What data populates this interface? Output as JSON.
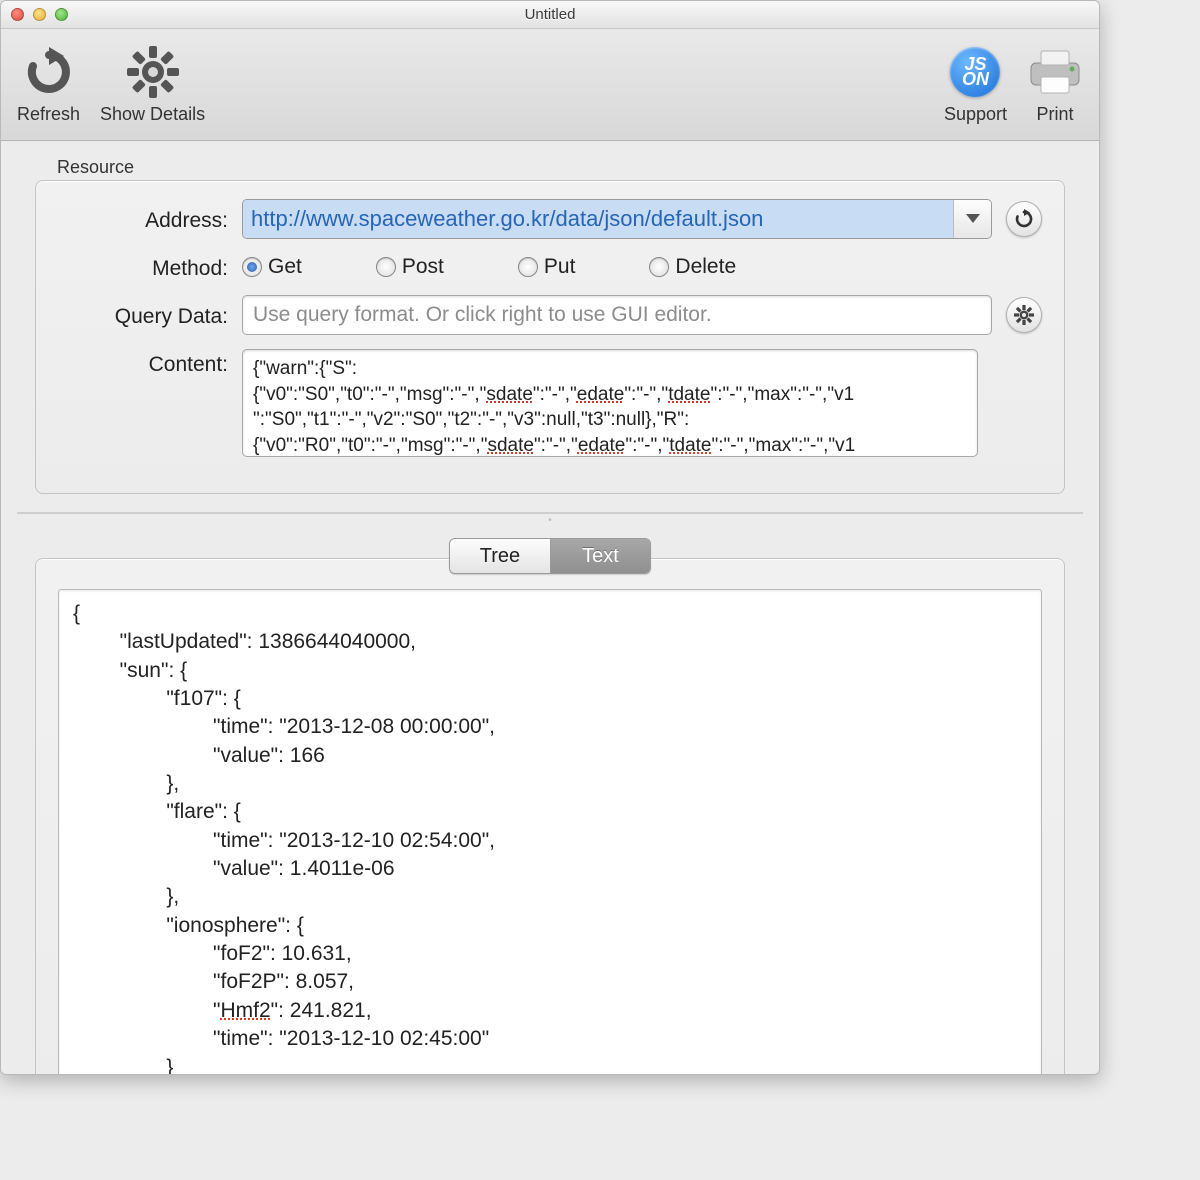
{
  "window": {
    "title": "Untitled"
  },
  "toolbar": {
    "refresh": "Refresh",
    "show_details": "Show Details",
    "support": "Support",
    "print": "Print",
    "json_badge": "JS\nON"
  },
  "resource": {
    "group_label": "Resource",
    "address_label": "Address:",
    "address_value": "http://www.spaceweather.go.kr/data/json/default.json",
    "method_label": "Method:",
    "methods": {
      "get": "Get",
      "post": "Post",
      "put": "Put",
      "delete": "Delete"
    },
    "selected_method": "get",
    "query_label": "Query Data:",
    "query_placeholder": "Use query format. Or click right to use GUI editor.",
    "content_label": "Content:",
    "content_lines": [
      "{\"warn\":{\"S\":",
      "{\"v0\":\"S0\",\"t0\":\"-\",\"msg\":\"-\",\"sdate\":\"-\",\"edate\":\"-\",\"tdate\":\"-\",\"max\":\"-\",\"v1",
      "\":\"S0\",\"t1\":\"-\",\"v2\":\"S0\",\"t2\":\"-\",\"v3\":null,\"t3\":null},\"R\":",
      "{\"v0\":\"R0\",\"t0\":\"-\",\"msg\":\"-\",\"sdate\":\"-\",\"edate\":\"-\",\"tdate\":\"-\",\"max\":\"-\",\"v1"
    ]
  },
  "tabs": {
    "tree": "Tree",
    "text": "Text",
    "active": "text"
  },
  "response_text": "{\n        \"lastUpdated\": 1386644040000,\n        \"sun\": {\n                \"f107\": {\n                        \"time\": \"2013-12-08 00:00:00\",\n                        \"value\": 166\n                },\n                \"flare\": {\n                        \"time\": \"2013-12-10 02:54:00\",\n                        \"value\": 1.4011e-06\n                },\n                \"ionosphere\": {\n                        \"foF2\": 10.631,\n                        \"foF2P\": 8.057,\n                        \"Hmf2\": 241.821,\n                        \"time\": \"2013-12-10 02:45:00\"\n                }"
}
